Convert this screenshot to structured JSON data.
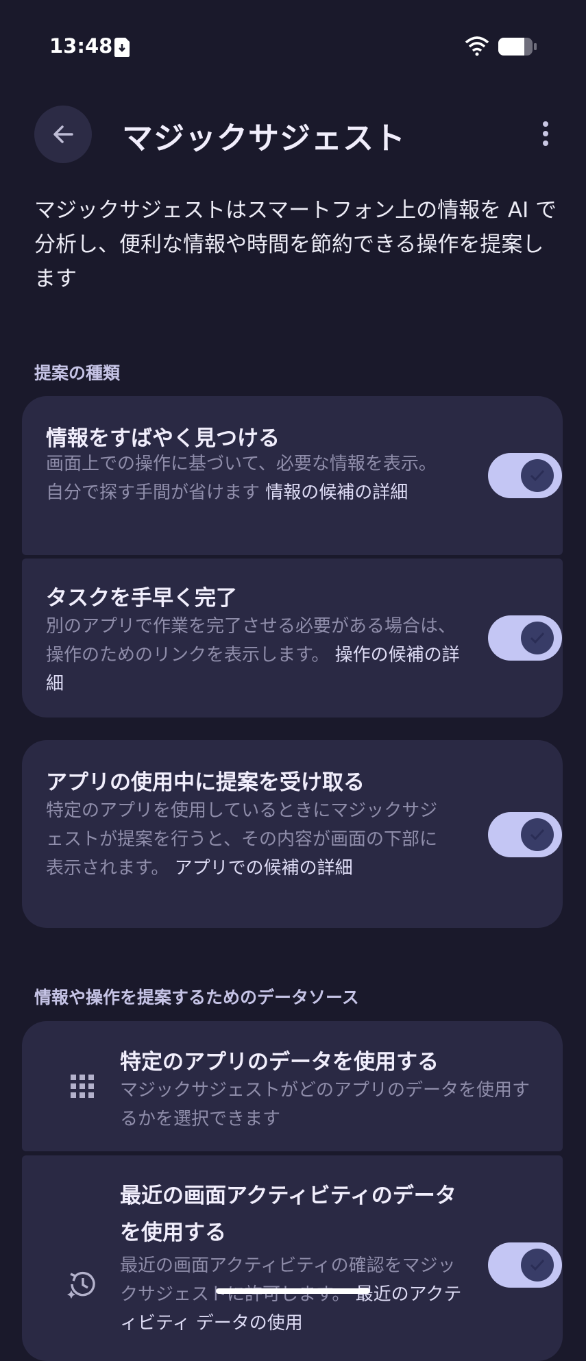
{
  "status_bar": {
    "time": "13:48"
  },
  "header": {
    "title": "マジックサジェスト"
  },
  "intro": "マジックサジェストはスマートフォン上の情報を AI で分析し、便利な情報や時間を節約できる操作を提案します",
  "section1": {
    "title": "提案の種類",
    "items": [
      {
        "title": "情報をすばやく見つける",
        "desc": "画面上での操作に基づいて、必要な情報を表示。自分で探す手間が省けます",
        "link": "情報の候補の詳細",
        "enabled": true
      },
      {
        "title": "タスクを手早く完了",
        "desc": "別のアプリで作業を完了させる必要がある場合は、操作のためのリンクを表示します。",
        "link": "操作の候補の詳細",
        "enabled": true
      },
      {
        "title": "アプリの使用中に提案を受け取る",
        "desc": "特定のアプリを使用しているときにマジックサジェストが提案を行うと、その内容が画面の下部に表示されます。",
        "link": "アプリでの候補の詳細",
        "enabled": true
      }
    ]
  },
  "section2": {
    "title": "情報や操作を提案するためのデータソース",
    "items": [
      {
        "title": "特定のアプリのデータを使用する",
        "desc": "マジックサジェストがどのアプリのデータを使用するかを選択できます",
        "icon": "apps-grid-icon"
      },
      {
        "title": "最近の画面アクティビティのデータを使用する",
        "desc": "最近の画面アクティビティの確認をマジックサジェストに許可します。",
        "link": "最近のアクティビティ データの使用",
        "icon": "history-icon",
        "enabled": true
      }
    ]
  },
  "colors": {
    "background": "#1a192b",
    "card": "#2a2944",
    "toggle_track": "#c4c6f4",
    "toggle_thumb": "#383c67"
  }
}
